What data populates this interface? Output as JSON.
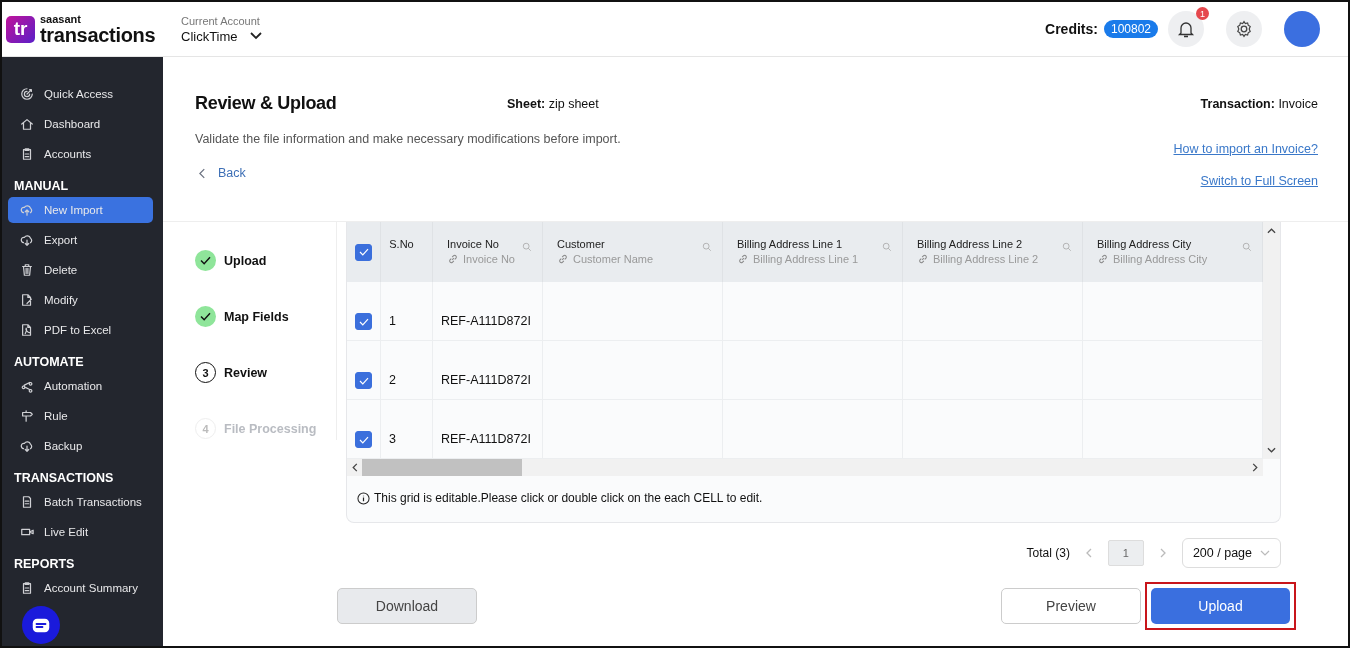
{
  "header": {
    "logo": {
      "mark": "tr",
      "brand": "saasant",
      "product": "transactions"
    },
    "account": {
      "label": "Current Account",
      "value": "ClickTime"
    },
    "credits": {
      "label": "Credits:",
      "value": "100802"
    },
    "notifications": {
      "count": "1"
    }
  },
  "sidebar": {
    "sections": [
      {
        "items": [
          {
            "label": "Quick Access",
            "selected": false
          },
          {
            "label": "Dashboard",
            "selected": false
          },
          {
            "label": "Accounts",
            "selected": false
          }
        ]
      },
      {
        "heading": "MANUAL",
        "items": [
          {
            "label": "New Import",
            "selected": true
          },
          {
            "label": "Export",
            "selected": false
          },
          {
            "label": "Delete",
            "selected": false
          },
          {
            "label": "Modify",
            "selected": false
          },
          {
            "label": "PDF to Excel",
            "selected": false
          }
        ]
      },
      {
        "heading": "AUTOMATE",
        "items": [
          {
            "label": "Automation",
            "selected": false
          },
          {
            "label": "Rule",
            "selected": false
          },
          {
            "label": "Backup",
            "selected": false
          }
        ]
      },
      {
        "heading": "TRANSACTIONS",
        "items": [
          {
            "label": "Batch Transactions",
            "selected": false
          },
          {
            "label": "Live Edit",
            "selected": false
          }
        ]
      },
      {
        "heading": "REPORTS",
        "items": [
          {
            "label": "Account Summary",
            "selected": false
          }
        ]
      }
    ]
  },
  "page": {
    "title": "Review & Upload",
    "sheet": {
      "label": "Sheet:",
      "value": "zip sheet"
    },
    "transaction": {
      "label": "Transaction:",
      "value": "Invoice"
    },
    "subtitle": "Validate the file information and make necessary modifications before import.",
    "back": "Back",
    "links": [
      "How to import an Invoice?",
      "Switch to Full Screen"
    ]
  },
  "steps": [
    {
      "label": "Upload",
      "completed": true,
      "active": false
    },
    {
      "label": "Map Fields",
      "completed": true,
      "active": false
    },
    {
      "number": "3",
      "label": "Review",
      "completed": false,
      "active": true
    },
    {
      "number": "4",
      "label": "File Processing",
      "completed": false,
      "active": false
    }
  ],
  "table": {
    "all_checked": true,
    "columns": [
      {
        "title": "S.No"
      },
      {
        "title": "Invoice No",
        "mapped": "Invoice No"
      },
      {
        "title": "Customer",
        "mapped": "Customer Name"
      },
      {
        "title": "Billing Address Line 1",
        "mapped": "Billing Address Line 1"
      },
      {
        "title": "Billing Address Line 2",
        "mapped": "Billing Address Line 2"
      },
      {
        "title": "Billing Address City",
        "mapped": "Billing Address City"
      }
    ],
    "rows": [
      {
        "checked": true,
        "sno": "1",
        "invoice_no": "REF-A111D872I"
      },
      {
        "checked": true,
        "sno": "2",
        "invoice_no": "REF-A111D872I"
      },
      {
        "checked": true,
        "sno": "3",
        "invoice_no": "REF-A111D872I"
      }
    ],
    "note": "This grid is editable.Please click or double click on the each CELL to edit."
  },
  "pagination": {
    "total": "Total (3)",
    "page": "1",
    "page_size": "200 / page"
  },
  "buttons": {
    "download": "Download",
    "preview": "Preview",
    "upload": {
      "label": "Upload",
      "highlighted": true
    }
  }
}
